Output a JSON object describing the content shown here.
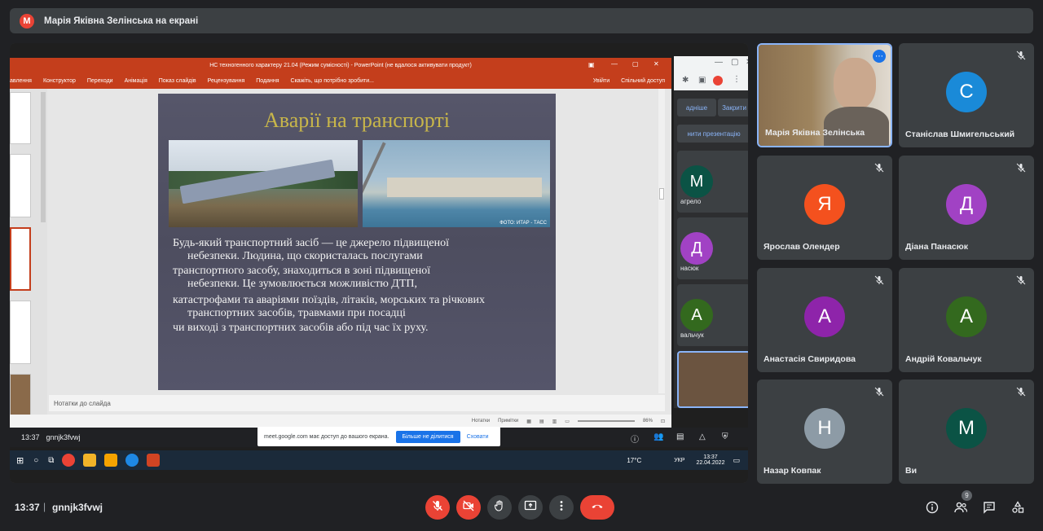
{
  "topbar": {
    "avatar_letter": "М",
    "title": "Марія Яківна Зелінська на екрані"
  },
  "ppt": {
    "window_title": "НС техногенного характеру 21.04 (Режим сумісності) - PowerPoint (не вдалося активувати продукт)",
    "ribbon": [
      "авлення",
      "Конструктор",
      "Переходи",
      "Анімація",
      "Показ слайдів",
      "Рецензування",
      "Подання",
      "Скажіть, що потрібно зробити..."
    ],
    "sign_in": "Увійти",
    "share": "Спільний доступ",
    "slide_title": "Аварії на транспорті",
    "photo_caption": "ФОТО: ИТАР - ТАСС",
    "slide_lines": [
      "Будь-який транспортний засіб — це джерело підвищеної",
      "небезпеки. Людина, що скористалась послугами",
      "транспортного засобу, знаходиться в зоні підвищеної",
      "небезпеки. Це зумовлюється можливістю ДТП,",
      "катастрофами та аваріями поїздів, літаків, морських та річкових",
      "транспортних засобів, травмами при посадці",
      "чи виході з транспортних засобів або під час їх руху."
    ],
    "notes_placeholder": "Нотатки до слайда",
    "status_notes": "Нотатки",
    "status_comments": "Примітки",
    "zoom": "86%"
  },
  "chrome": {
    "hide": "адніше",
    "close": "Закрити",
    "change": "нити презентацію",
    "tiles": [
      {
        "letter": "М",
        "name": "агрело"
      },
      {
        "letter": "Д",
        "name": "насюк"
      },
      {
        "letter": "А",
        "name": "вальчук"
      }
    ]
  },
  "inner_meet": {
    "time": "13:37",
    "code": "gnnjk3fvwj"
  },
  "notice": {
    "text": "meet.google.com має доступ до вашого екрана.",
    "stop": "Більше не ділитися",
    "hide": "Сховати"
  },
  "taskbar": {
    "weather": "17°C",
    "lang": "УКР",
    "time": "13:37",
    "date": "22.04.2022"
  },
  "participants": [
    {
      "name": "Марія Яківна Зелінська",
      "letter": "",
      "color": ""
    },
    {
      "name": "Станіслав Шмигельський",
      "letter": "С",
      "color": "#1a8ad8"
    },
    {
      "name": "Ярослав Олендер",
      "letter": "Я",
      "color": "#f4511e"
    },
    {
      "name": "Діана Панасюк",
      "letter": "Д",
      "color": "#a142c4"
    },
    {
      "name": "Анастасія Свиридова",
      "letter": "А",
      "color": "#8e24aa"
    },
    {
      "name": "Андрій Ковальчук",
      "letter": "А",
      "color": "#33691e"
    },
    {
      "name": "Назар Ковпак",
      "letter": "Н",
      "color": "#8d9ba6"
    },
    {
      "name": "Ви",
      "letter": "М",
      "color": "#0b5345"
    }
  ],
  "bottom": {
    "time": "13:37",
    "separator": "|",
    "code": "gnnjk3fvwj",
    "people_count": "9"
  },
  "colors": {
    "end_call": "#ea4335",
    "control_bg": "#3c4043",
    "accent": "#8ab4f8"
  }
}
